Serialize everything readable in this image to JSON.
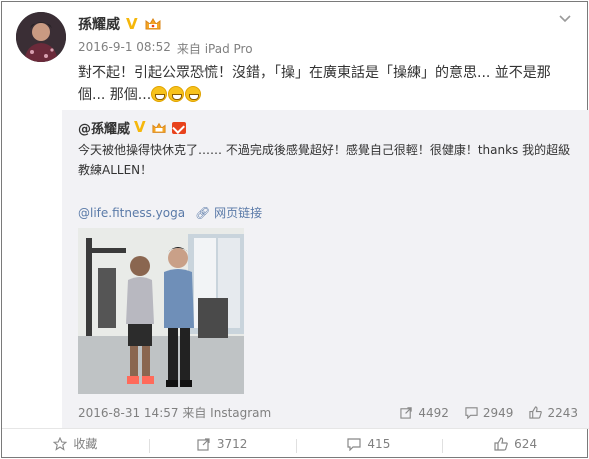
{
  "post": {
    "author": "孫耀威",
    "date": "2016-9-1 08:52",
    "source_prefix": "来自",
    "source": "iPad Pro",
    "text": "對不起！引起公眾恐慌！沒錯，「操」在廣東話是「操練」的意思... 並不是那個... 那個...",
    "emoji_count": 3
  },
  "repost": {
    "author": "@孫耀威",
    "text": "今天被他操得快休克了…… 不過完成後感覺超好！感覺自己很輕！很健康！thanks 我的超級教練ALLEN！",
    "mention": "@life.fitness.yoga",
    "web_link_label": "网页链接",
    "date": "2016-8-31 14:57",
    "source_prefix": "来自",
    "source": "Instagram",
    "stats": {
      "reposts": "4492",
      "comments": "2949",
      "likes": "2243"
    }
  },
  "actions": {
    "favorite_label": "收藏",
    "repost_count": "3712",
    "comment_count": "415",
    "like_count": "624"
  },
  "icons": {
    "verified": "verified-v-icon",
    "crown": "crown-member-icon",
    "chevron": "chevron-down-icon",
    "link": "link-icon",
    "repost": "repost-icon",
    "comment": "comment-icon",
    "like": "thumbs-up-icon",
    "favorite": "star-icon"
  },
  "colors": {
    "link": "#5a7aa8",
    "verified": "#f5b70b",
    "repost_bg": "#f2f2f5",
    "muted": "#808080"
  }
}
